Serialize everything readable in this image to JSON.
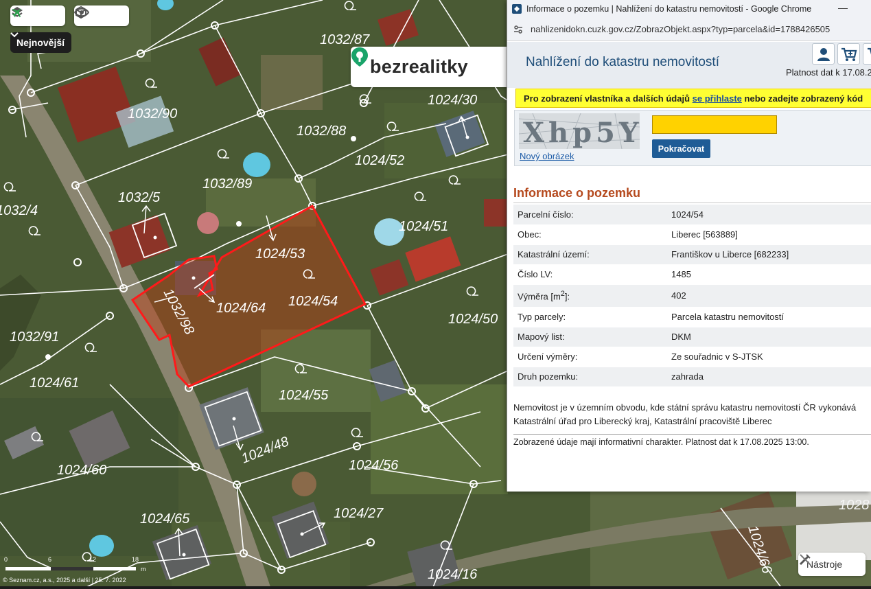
{
  "map": {
    "era_label": "Nejnovější",
    "brand": "bezrealitky",
    "scale_labels": [
      "0",
      "6",
      "12",
      "18",
      "m"
    ],
    "copyright": "© Seznam.cz, a.s., 2025 a další | 25. 7. 2022",
    "tools_label": "Nástroje",
    "toolbar_icons": [
      "layers-icon",
      "airplane-icon",
      "3d-cube-icon",
      "eye-icon"
    ],
    "parcels": [
      "1032/87",
      "1032/90",
      "1032/88",
      "1024/30",
      "1024/52",
      "1032/89",
      "1032/4",
      "1032/5",
      "1024/51",
      "1024/53",
      "1024/54",
      "1024/64",
      "1032/98",
      "1024/50",
      "1032/91",
      "1024/61",
      "1024/55",
      "1024/48",
      "1024/60",
      "1024/56",
      "1024/27",
      "1024/65",
      "1024/16",
      "1024/66",
      "1028"
    ],
    "highlight_color": "#ff1a1a"
  },
  "browser": {
    "window_title": "Informace o pozemku | Nahlížení do katastru nemovitostí - Google Chrome",
    "url": "nahlizenidokn.cuzk.gov.cz/ZobrazObjekt.aspx?typ=parcela&id=1788426505",
    "minimize_symbol": "—"
  },
  "site": {
    "title": "Nahlížení do katastru nemovitostí",
    "validity_top": "Platnost dat k 17.08.2",
    "header_icons": [
      "user-icon",
      "cart-icon",
      "cart-plus-icon"
    ],
    "login_note": {
      "before": "Pro zobrazení vlastníka a dalších údajů ",
      "link": "se přihlaste",
      "after": " nebo zadejte zobrazený kód"
    },
    "captcha": {
      "image_text": "Xhp5Y",
      "new_image": "Nový obrázek",
      "input_value": "",
      "continue": "Pokračovat"
    },
    "section_title": "Informace o pozemku",
    "rows": [
      {
        "key": "Parcelní číslo:",
        "value": "1024/54"
      },
      {
        "key": "Obec:",
        "value": "Liberec [563889]"
      },
      {
        "key": "Katastrální území:",
        "value": "Františkov u Liberce [682233]"
      },
      {
        "key": "Číslo LV:",
        "value": "1485"
      },
      {
        "key_pre": "Výměra [m",
        "key_sup": "2",
        "key_post": "]:",
        "value": "402"
      },
      {
        "key": "Typ parcely:",
        "value": "Parcela katastru nemovitostí"
      },
      {
        "key": "Mapový list:",
        "value": "DKM"
      },
      {
        "key": "Určení výměry:",
        "value": "Ze souřadnic v S-JTSK"
      },
      {
        "key": "Druh pozemku:",
        "value": "zahrada"
      }
    ],
    "note": "Nemovitost je v územním obvodu, kde státní správu katastru nemovitostí ČR vykonává Katastrální úřad pro Liberecký kraj, Katastrální pracoviště Liberec",
    "footnote": "Zobrazené údaje mají informativní charakter. Platnost dat k 17.08.2025 13:00."
  }
}
